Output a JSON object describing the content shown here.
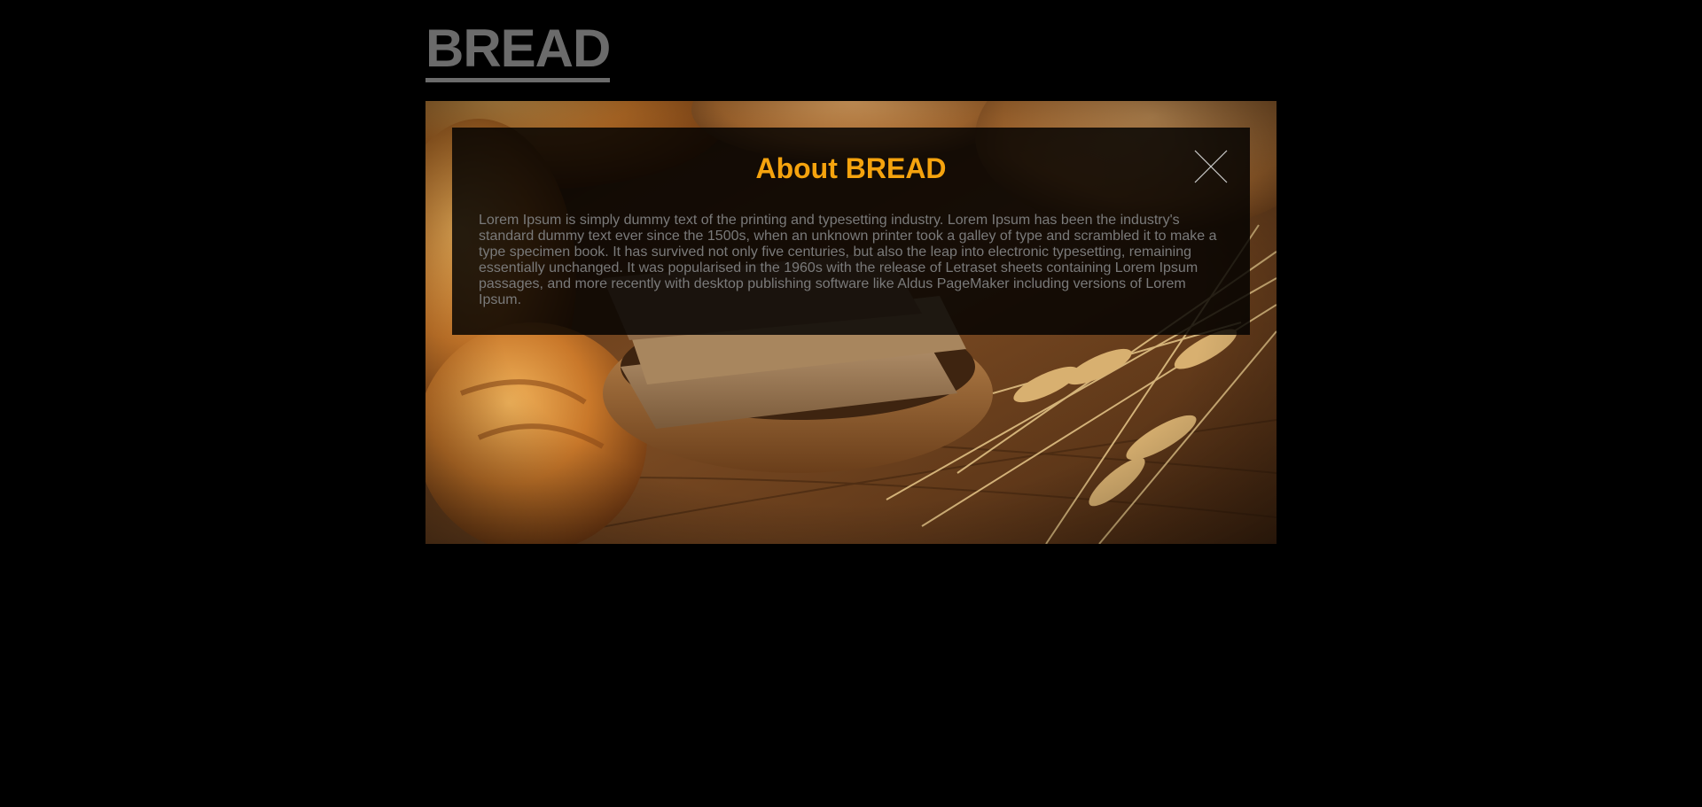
{
  "header": {
    "logo_text": "BREAD"
  },
  "modal": {
    "title": "About BREAD",
    "body": "Lorem Ipsum is simply dummy text of the printing and typesetting industry. Lorem Ipsum has been the industry's standard dummy text ever since the 1500s, when an unknown printer took a galley of type and scrambled it to make a type specimen book. It has survived not only five centuries, but also the leap into electronic typesetting, remaining essentially unchanged. It was popularised in the 1960s with the release of Letraset sheets containing Lorem Ipsum passages, and more recently with desktop publishing software like Aldus PageMaker including versions of Lorem Ipsum.",
    "close_icon": "close-icon"
  },
  "hero": {
    "image_subject": "bread loaves and wheat stalks on wooden table"
  },
  "colors": {
    "background": "#000000",
    "logo": "#6b6b6b",
    "accent": "#f5a30e",
    "body_text": "#7a7a7a",
    "overlay": "rgba(0,0,0,0.82)"
  }
}
